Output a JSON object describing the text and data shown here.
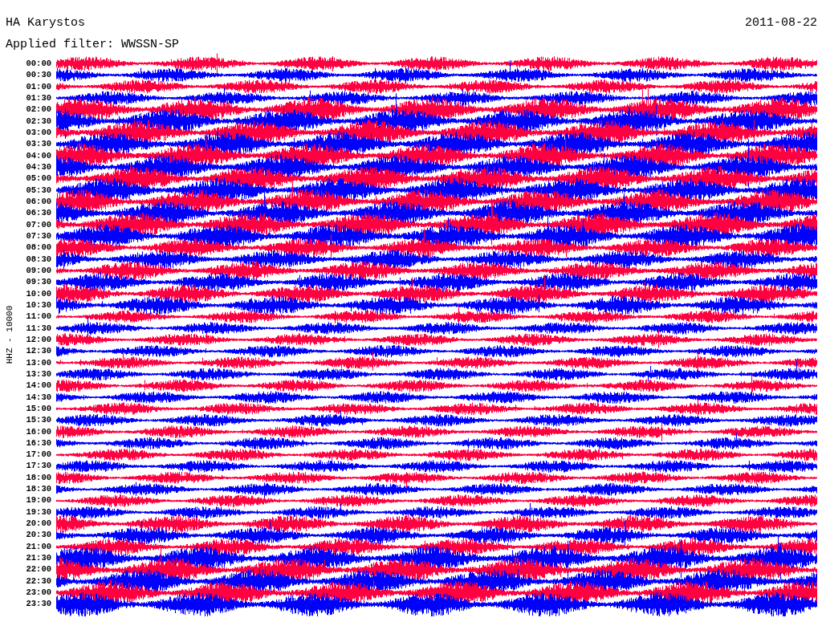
{
  "station": "HA Karystos",
  "date": "2011-08-22",
  "filter": "Applied filter: WWSSN-SP",
  "channel": "HHZ - 10000",
  "rows": [
    {
      "time": "00:00",
      "color": "#ff0040"
    },
    {
      "time": "00:30",
      "color": "#0000ff"
    },
    {
      "time": "01:00",
      "color": "#ff0040"
    },
    {
      "time": "01:30",
      "color": "#0000ff"
    },
    {
      "time": "02:00",
      "color": "#ff0040"
    },
    {
      "time": "02:30",
      "color": "#0000ff"
    },
    {
      "time": "03:00",
      "color": "#ff0040"
    },
    {
      "time": "03:30",
      "color": "#0000ff"
    },
    {
      "time": "04:00",
      "color": "#ff0040"
    },
    {
      "time": "04:30",
      "color": "#0000ff"
    },
    {
      "time": "05:00",
      "color": "#ff0040"
    },
    {
      "time": "05:30",
      "color": "#0000ff"
    },
    {
      "time": "06:00",
      "color": "#ff0040"
    },
    {
      "time": "06:30",
      "color": "#0000ff"
    },
    {
      "time": "07:00",
      "color": "#ff0040"
    },
    {
      "time": "07:30",
      "color": "#0000ff"
    },
    {
      "time": "08:00",
      "color": "#ff0040"
    },
    {
      "time": "08:30",
      "color": "#0000ff"
    },
    {
      "time": "09:00",
      "color": "#ff0040"
    },
    {
      "time": "09:30",
      "color": "#0000ff"
    },
    {
      "time": "10:00",
      "color": "#ff0040"
    },
    {
      "time": "10:30",
      "color": "#0000ff"
    },
    {
      "time": "11:00",
      "color": "#ff0040"
    },
    {
      "time": "11:30",
      "color": "#0000ff"
    },
    {
      "time": "12:00",
      "color": "#ff0040"
    },
    {
      "time": "12:30",
      "color": "#0000ff"
    },
    {
      "time": "13:00",
      "color": "#ff0040"
    },
    {
      "time": "13:30",
      "color": "#0000ff"
    },
    {
      "time": "14:00",
      "color": "#ff0040"
    },
    {
      "time": "14:30",
      "color": "#0000ff"
    },
    {
      "time": "15:00",
      "color": "#ff0040"
    },
    {
      "time": "15:30",
      "color": "#0000ff"
    },
    {
      "time": "16:00",
      "color": "#ff0040"
    },
    {
      "time": "16:30",
      "color": "#0000ff"
    },
    {
      "time": "17:00",
      "color": "#ff0040"
    },
    {
      "time": "17:30",
      "color": "#0000ff"
    },
    {
      "time": "18:00",
      "color": "#ff0040"
    },
    {
      "time": "18:30",
      "color": "#0000ff"
    },
    {
      "time": "19:00",
      "color": "#ff0040"
    },
    {
      "time": "19:30",
      "color": "#0000ff"
    },
    {
      "time": "20:00",
      "color": "#ff0040"
    },
    {
      "time": "20:30",
      "color": "#0000ff"
    },
    {
      "time": "21:00",
      "color": "#ff0040"
    },
    {
      "time": "21:30",
      "color": "#0000ff"
    },
    {
      "time": "22:00",
      "color": "#ff0040"
    },
    {
      "time": "22:30",
      "color": "#0000ff"
    },
    {
      "time": "23:00",
      "color": "#ff0040"
    },
    {
      "time": "23:30",
      "color": "#0000ff"
    }
  ]
}
